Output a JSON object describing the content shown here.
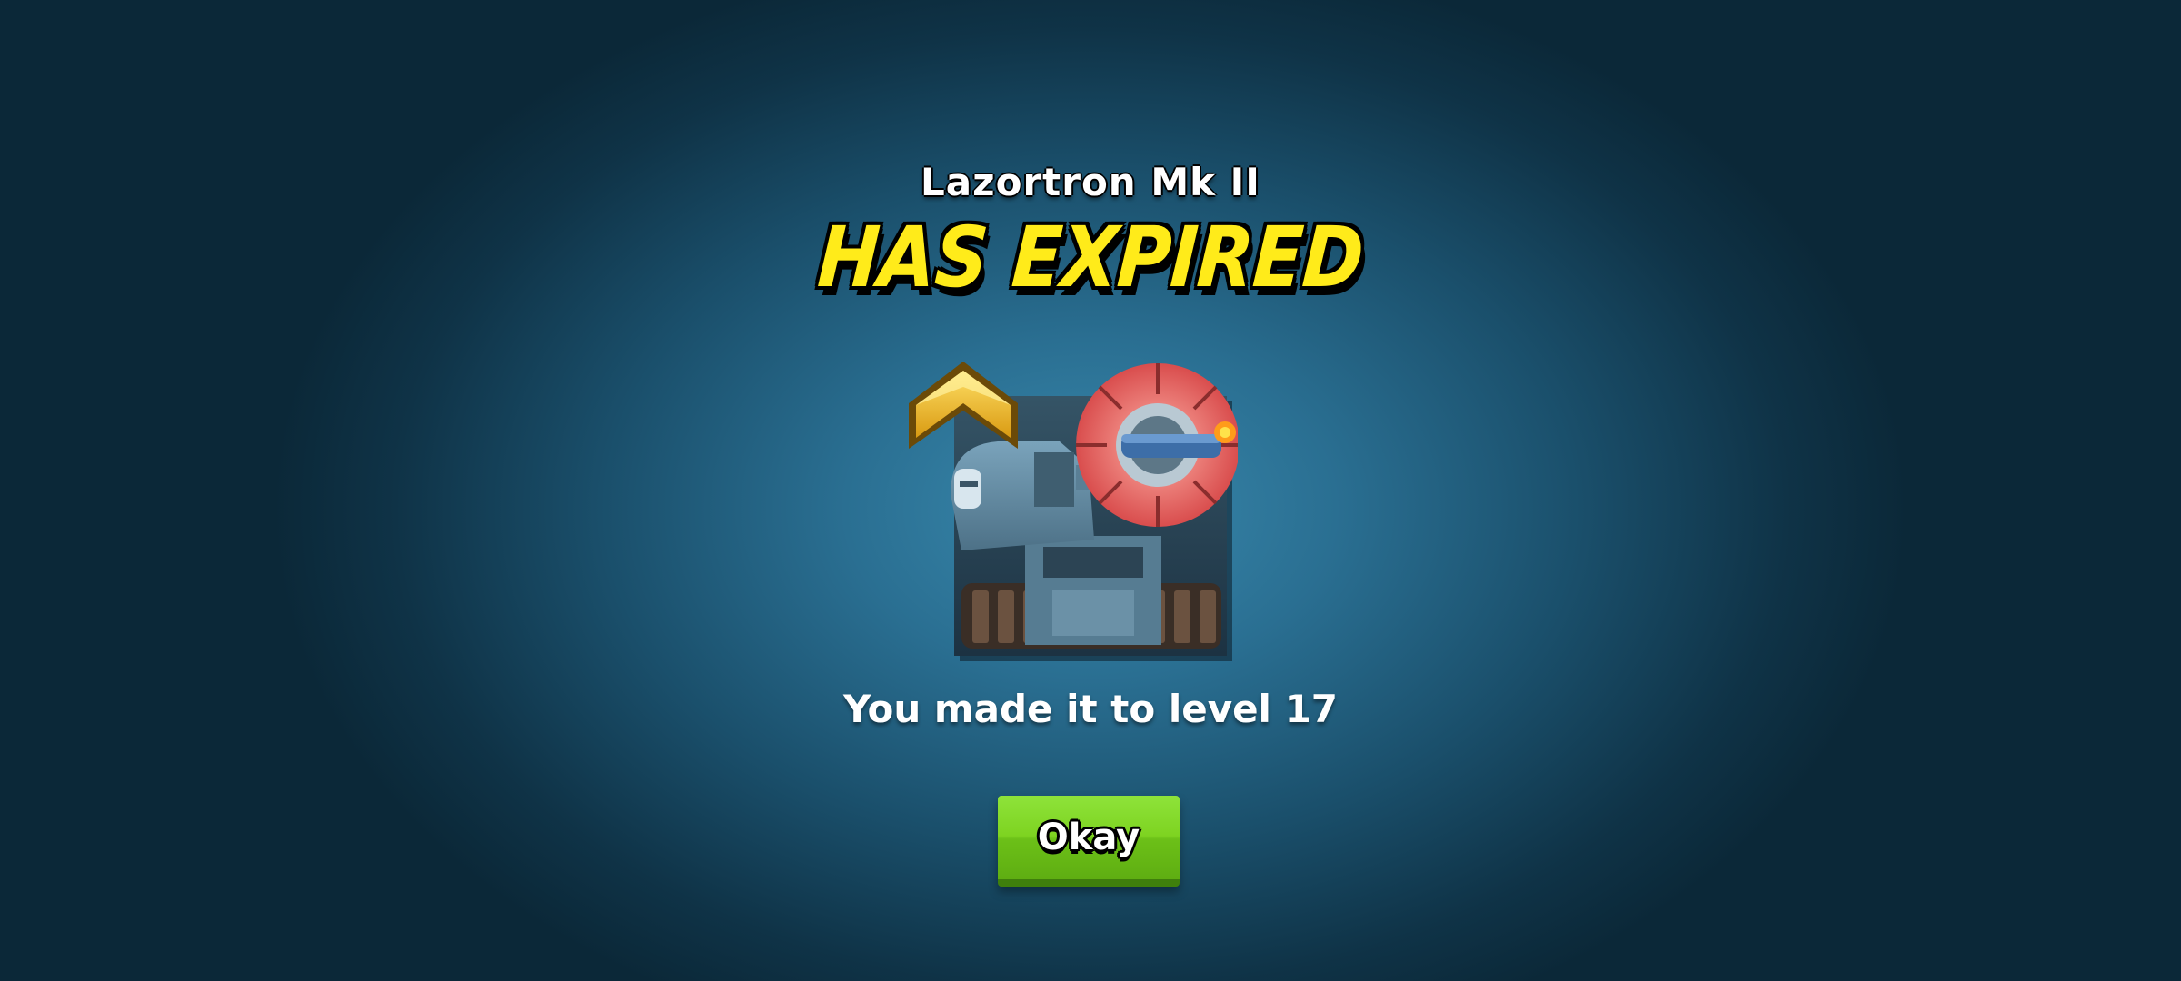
{
  "popup": {
    "item_name": "Lazortron Mk II",
    "headline": "HAS EXPIRED",
    "level_message": "You made it to level 17",
    "okay_label": "Okay"
  },
  "portrait": {
    "unit_icon": "laser-tank-icon",
    "rank_icon": "gold-chevron-rank-icon"
  },
  "colors": {
    "headline_yellow": "#ffeb1a",
    "button_green": "#7ed321",
    "background_blue": "#2a6f92",
    "laser_red": "#e86060"
  }
}
